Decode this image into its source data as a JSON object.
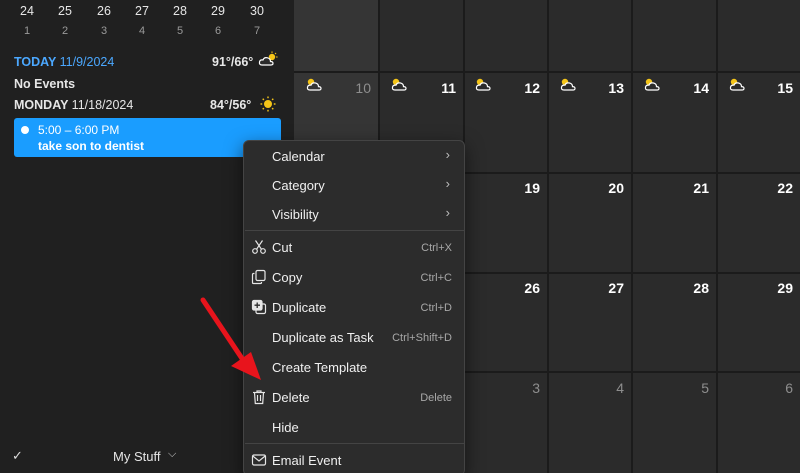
{
  "mini_calendar": {
    "dates": [
      "24",
      "25",
      "26",
      "27",
      "28",
      "29",
      "30"
    ],
    "weeks": [
      "1",
      "2",
      "3",
      "4",
      "5",
      "6",
      "7"
    ]
  },
  "agenda": {
    "today_label": "TODAY",
    "today_date": "11/9/2024",
    "today_temp": "91°/66°",
    "today_weather_icon": "partly-cloudy-icon",
    "no_events": "No Events",
    "monday_label": "MONDAY",
    "monday_date": "11/18/2024",
    "monday_temp": "84°/56°",
    "monday_weather_icon": "sunny-icon",
    "event": {
      "time": "5:00 – 6:00 PM",
      "title": "take son to dentist",
      "color": "#1a9dff"
    }
  },
  "footer": {
    "check_icon": "checkmark-icon",
    "calendar_set": "My Stuff"
  },
  "calendar_grid": {
    "row2_days": [
      "10",
      "11",
      "12",
      "13",
      "14",
      "15"
    ],
    "row3_days": [
      "19",
      "20",
      "21",
      "22"
    ],
    "row4_days": [
      "26",
      "27",
      "28",
      "29"
    ],
    "row5_days": [
      "3",
      "4",
      "5",
      "6"
    ]
  },
  "context_menu": {
    "items": [
      {
        "label": "Calendar",
        "shortcut": "",
        "submenu": true,
        "icon": ""
      },
      {
        "label": "Category",
        "shortcut": "",
        "submenu": true,
        "icon": ""
      },
      {
        "label": "Visibility",
        "shortcut": "",
        "submenu": true,
        "icon": ""
      },
      {
        "label": "Cut",
        "shortcut": "Ctrl+X",
        "submenu": false,
        "icon": "scissors-icon"
      },
      {
        "label": "Copy",
        "shortcut": "Ctrl+C",
        "submenu": false,
        "icon": "copy-icon"
      },
      {
        "label": "Duplicate",
        "shortcut": "Ctrl+D",
        "submenu": false,
        "icon": "duplicate-icon"
      },
      {
        "label": "Duplicate as Task",
        "shortcut": "Ctrl+Shift+D",
        "submenu": false,
        "icon": ""
      },
      {
        "label": "Create Template",
        "shortcut": "",
        "submenu": false,
        "icon": ""
      },
      {
        "label": "Delete",
        "shortcut": "Delete",
        "submenu": false,
        "icon": "trash-icon"
      },
      {
        "label": "Hide",
        "shortcut": "",
        "submenu": false,
        "icon": ""
      },
      {
        "label": "Email Event",
        "shortcut": "",
        "submenu": false,
        "icon": "mail-icon"
      }
    ]
  },
  "colors": {
    "accent_blue": "#1a9dff",
    "today_blue": "#4ba8ff",
    "annotation_red": "#e8141c"
  }
}
